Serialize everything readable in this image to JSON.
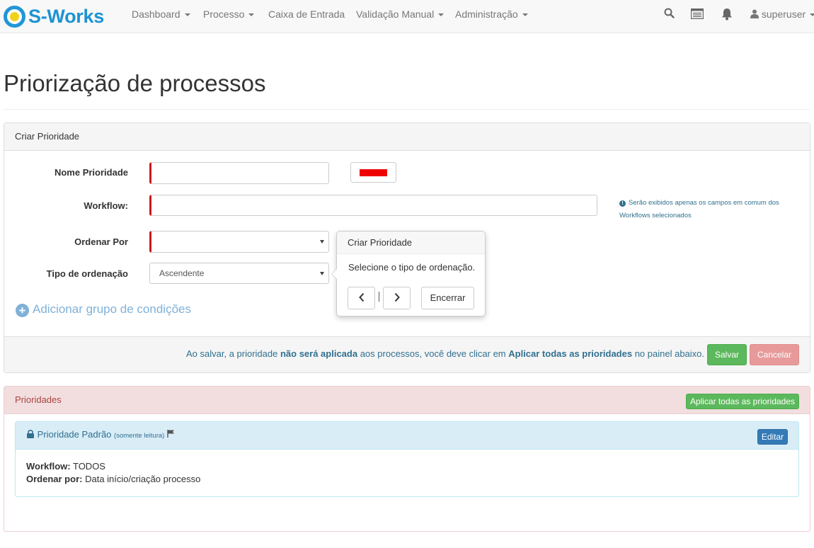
{
  "app": {
    "logo_text": "S-Works"
  },
  "nav": {
    "items": [
      {
        "label": "Dashboard",
        "dropdown": true
      },
      {
        "label": "Processo",
        "dropdown": true
      },
      {
        "label": "Caixa de Entrada",
        "dropdown": false
      },
      {
        "label": "Validação Manual",
        "dropdown": true
      },
      {
        "label": "Administração",
        "dropdown": true
      }
    ],
    "icons": [
      "search-icon",
      "inbox-list-icon",
      "bell-icon"
    ],
    "user": "superuser"
  },
  "page": {
    "title": "Priorização de processos"
  },
  "create_panel": {
    "heading": "Criar Prioridade",
    "fields": {
      "name_label": "Nome Prioridade",
      "name_value": "",
      "color_value": "#ee0000",
      "workflow_label": "Workflow:",
      "workflow_value": "",
      "order_by_label": "Ordenar Por",
      "order_by_value": "",
      "order_type_label": "Tipo de ordenação",
      "order_type_value": "Ascendente"
    },
    "info_note": "Serão exibidos apenas os campos em comum dos Workflows selecionados",
    "add_group": "Adicionar grupo de condições",
    "footer": {
      "text_1": "Ao salvar, a prioridade ",
      "text_bold_1": "não será aplicada",
      "text_2": " aos processos, você deve clicar em ",
      "text_bold_2": "Aplicar todas as prioridades",
      "text_3": " no painel abaixo.",
      "save_label": "Salvar",
      "cancel_label": "Cancelar"
    }
  },
  "tour_popover": {
    "title": "Criar Prioridade",
    "content": "Selecione o tipo de ordenação.",
    "prev_icon": "chevron-left-icon",
    "next_icon": "chevron-right-icon",
    "end_label": "Encerrar"
  },
  "priorities_panel": {
    "heading": "Prioridades",
    "apply_label": "Aplicar todas as prioridades",
    "default_priority": {
      "title": "Prioridade Padrão",
      "readonly_note": "(somente leitura)",
      "edit_label": "Editar",
      "workflow_key": "Workflow:",
      "workflow_value": "TODOS",
      "order_key": "Ordenar por:",
      "order_value": "Data início/criação processo"
    }
  }
}
